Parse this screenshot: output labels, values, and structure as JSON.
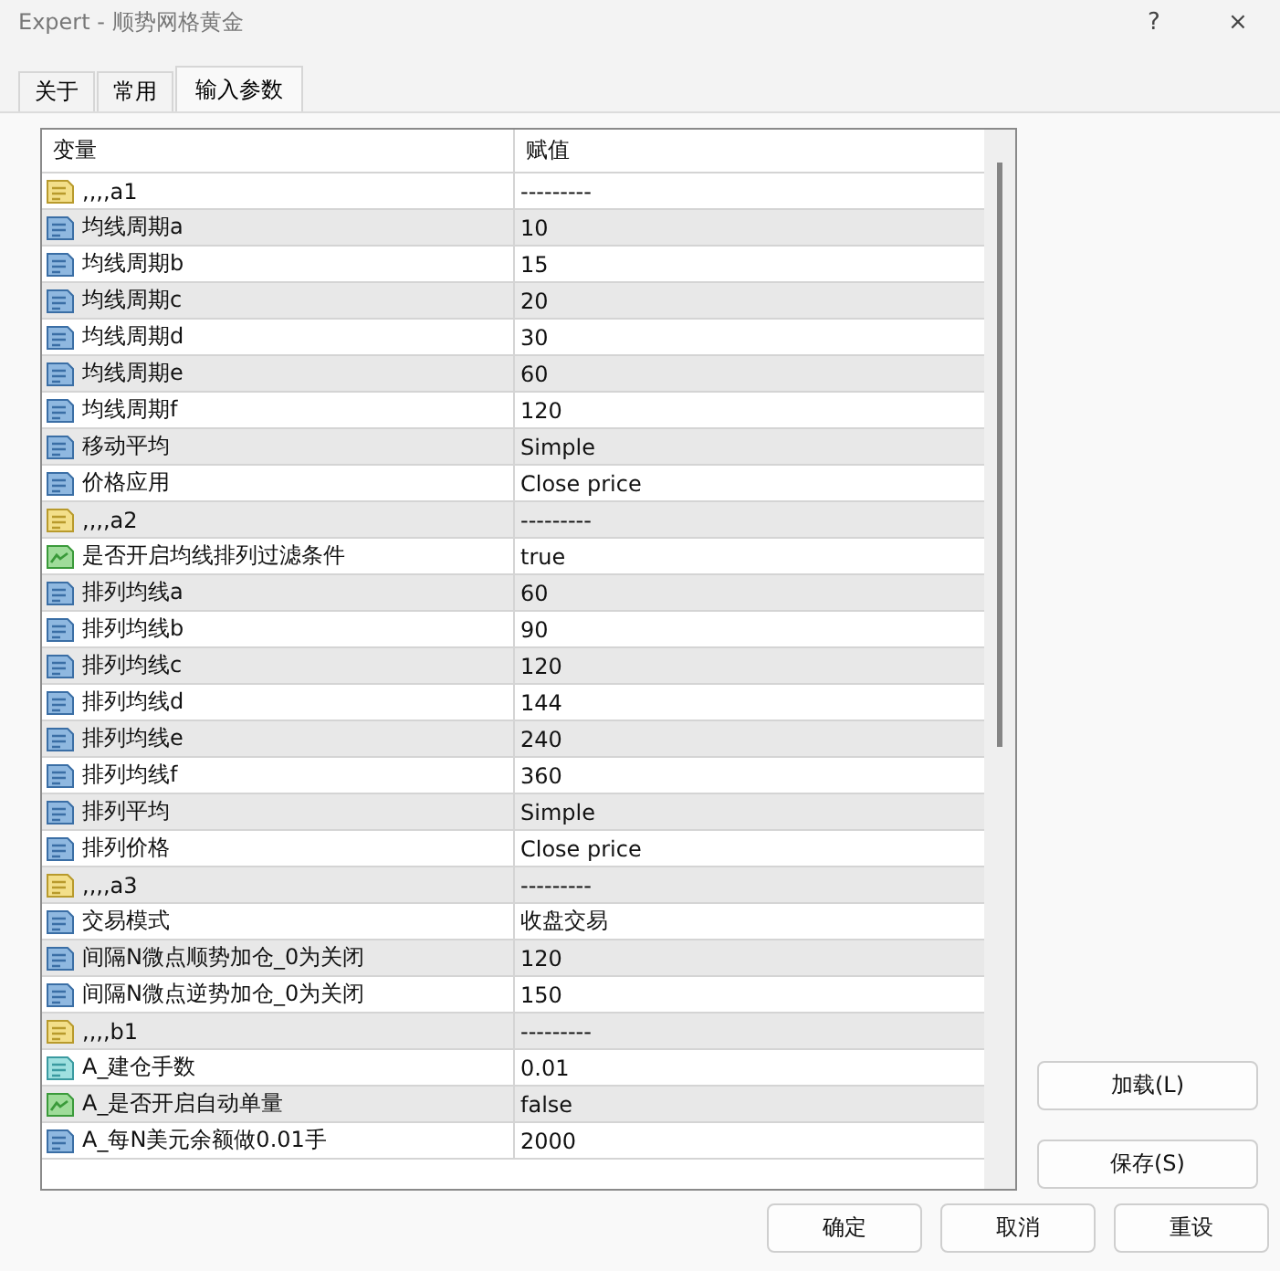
{
  "window": {
    "title": "Expert - 顺势网格黄金",
    "help": "?",
    "close": "×"
  },
  "tabs": [
    {
      "label": "关于",
      "selected": false
    },
    {
      "label": "常用",
      "selected": false
    },
    {
      "label": "输入参数",
      "selected": true
    }
  ],
  "table": {
    "columns": [
      "变量",
      "赋值"
    ],
    "rows": [
      {
        "kind": "string",
        "name": ",,,,a1",
        "value": "---------"
      },
      {
        "kind": "int",
        "name": "均线周期a",
        "value": "10"
      },
      {
        "kind": "int",
        "name": "均线周期b",
        "value": "15"
      },
      {
        "kind": "int",
        "name": "均线周期c",
        "value": "20"
      },
      {
        "kind": "int",
        "name": "均线周期d",
        "value": "30"
      },
      {
        "kind": "int",
        "name": "均线周期e",
        "value": "60"
      },
      {
        "kind": "int",
        "name": "均线周期f",
        "value": "120"
      },
      {
        "kind": "int",
        "name": "移动平均",
        "value": "Simple"
      },
      {
        "kind": "int",
        "name": "价格应用",
        "value": "Close price"
      },
      {
        "kind": "string",
        "name": ",,,,a2",
        "value": "---------"
      },
      {
        "kind": "bool",
        "name": "是否开启均线排列过滤条件",
        "value": "true"
      },
      {
        "kind": "int",
        "name": "排列均线a",
        "value": "60"
      },
      {
        "kind": "int",
        "name": "排列均线b",
        "value": "90"
      },
      {
        "kind": "int",
        "name": "排列均线c",
        "value": "120"
      },
      {
        "kind": "int",
        "name": "排列均线d",
        "value": "144"
      },
      {
        "kind": "int",
        "name": "排列均线e",
        "value": "240"
      },
      {
        "kind": "int",
        "name": "排列均线f",
        "value": "360"
      },
      {
        "kind": "int",
        "name": "排列平均",
        "value": "Simple"
      },
      {
        "kind": "int",
        "name": "排列价格",
        "value": "Close price"
      },
      {
        "kind": "string",
        "name": ",,,,a3",
        "value": "---------"
      },
      {
        "kind": "int",
        "name": "交易模式",
        "value": "收盘交易"
      },
      {
        "kind": "int",
        "name": "间隔N微点顺势加仓_0为关闭",
        "value": "120"
      },
      {
        "kind": "int",
        "name": "间隔N微点逆势加仓_0为关闭",
        "value": "150"
      },
      {
        "kind": "string",
        "name": ",,,,b1",
        "value": "---------"
      },
      {
        "kind": "double",
        "name": "A_建仓手数",
        "value": "0.01"
      },
      {
        "kind": "bool",
        "name": "A_是否开启自动单量",
        "value": "false"
      },
      {
        "kind": "int",
        "name": "A_每N美元余额做0.01手",
        "value": "2000"
      }
    ]
  },
  "side_buttons": [
    "加载(L)",
    "保存(S)"
  ],
  "buttons": [
    "确定",
    "取消",
    "重设"
  ]
}
